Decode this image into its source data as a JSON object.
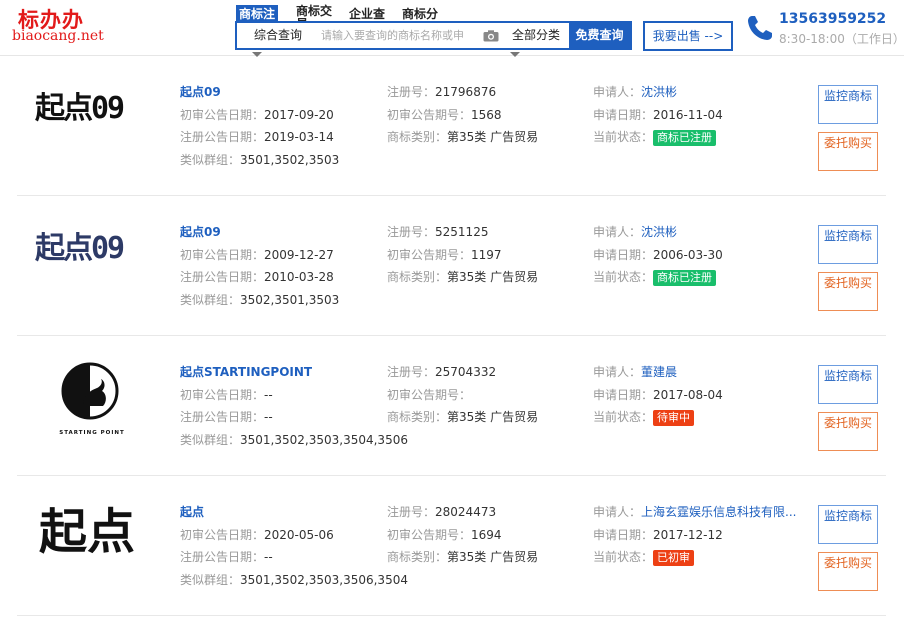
{
  "logo": {
    "title": "标办办",
    "domain": "biaocang.net"
  },
  "nav": {
    "tabs": [
      "商标注",
      "商标交易",
      "企业查",
      "商标分"
    ]
  },
  "search": {
    "type": "综合查询",
    "placeholder": "请输入要查询的商标名称或申",
    "category": "全部分类",
    "button": "免费查询"
  },
  "sell_button": "我要出售 -->",
  "contact": {
    "phone": "13563959252",
    "hours": "8:30-18:00（工作日）"
  },
  "labels": {
    "reg_no": "注册号：",
    "applicant": "申请人：",
    "first_date": "初审公告日期：",
    "first_period": "初审公告期号：",
    "apply_date": "申请日期：",
    "reg_date": "注册公告日期：",
    "category": "商标类别：",
    "status": "当前状态：",
    "group": "类似群组：",
    "monitor_btn": "监控商标",
    "entrust_btn": "委托购买"
  },
  "colors": {
    "primary": "#1e5fbf",
    "registered": "#19be6b",
    "pending": "#ed4014",
    "entrust": "#e2621e"
  },
  "results": [
    {
      "name": "起点09",
      "logo_text": "起点09",
      "logo_style": "black-pixel",
      "reg_no": "21796876",
      "applicant": "沈洪彬",
      "first_date": "2017-09-20",
      "first_period": "1568",
      "apply_date": "2016-11-04",
      "reg_date": "2019-03-14",
      "category": "第35类 广告贸易",
      "status": "商标已注册",
      "status_color": "#19be6b",
      "group": "3501,3502,3503"
    },
    {
      "name": "起点09",
      "logo_text": "起点09",
      "logo_style": "navy-pixel",
      "reg_no": "5251125",
      "applicant": "沈洪彬",
      "first_date": "2009-12-27",
      "first_period": "1197",
      "apply_date": "2006-03-30",
      "reg_date": "2010-03-28",
      "category": "第35类 广告贸易",
      "status": "商标已注册",
      "status_color": "#19be6b",
      "group": "3502,3501,3503"
    },
    {
      "name": "起点STARTINGPOINT",
      "logo_text": "STARTING POINT",
      "logo_style": "circle-emblem",
      "reg_no": "25704332",
      "applicant": "董建晨",
      "first_date": "--",
      "first_period": "",
      "apply_date": "2017-08-04",
      "reg_date": "--",
      "category": "第35类 广告贸易",
      "status": "待审中",
      "status_color": "#ed4014",
      "group": "3501,3502,3503,3504,3506"
    },
    {
      "name": "起点",
      "logo_text": "起点",
      "logo_style": "brush",
      "reg_no": "28024473",
      "applicant": "上海玄霆娱乐信息科技有限...",
      "first_date": "2020-05-06",
      "first_period": "1694",
      "apply_date": "2017-12-12",
      "reg_date": "--",
      "category": "第35类 广告贸易",
      "status": "已初审",
      "status_color": "#ed4014",
      "group": "3501,3502,3503,3506,3504"
    }
  ]
}
